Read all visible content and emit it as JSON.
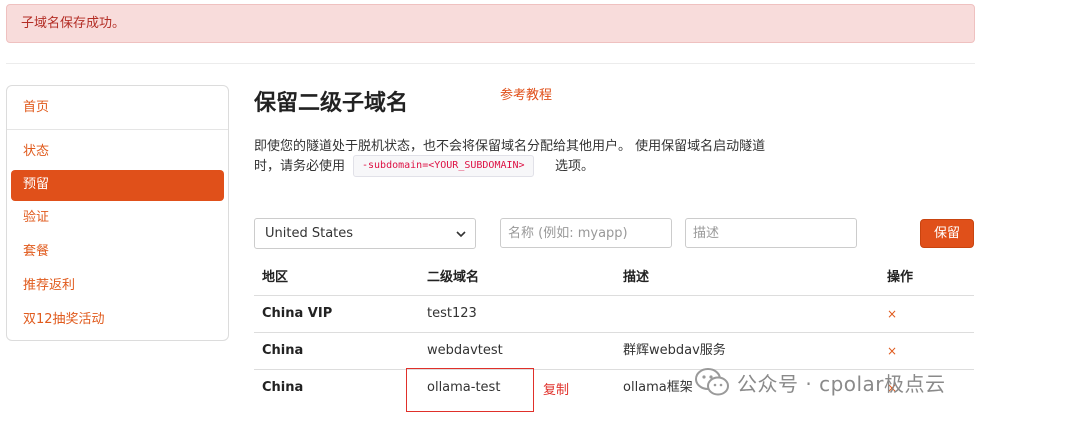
{
  "alert": {
    "message": "子域名保存成功。"
  },
  "sidebar": {
    "items": [
      {
        "label": "首页"
      },
      {
        "label": "状态"
      },
      {
        "label": "预留"
      },
      {
        "label": "验证"
      },
      {
        "label": "套餐"
      },
      {
        "label": "推荐返利"
      },
      {
        "label": "双12抽奖活动"
      }
    ],
    "active_index": 2
  },
  "main": {
    "title": "保留二级子域名",
    "tutorial_link": "参考教程",
    "description_line1": "即使您的隧道处于脱机状态，也不会将保留域名分配给其他用户。 使用保留域名启动隧道",
    "description_line2_prefix": "时，请务必使用",
    "description_code": "-subdomain=<YOUR_SUBDOMAIN>",
    "description_line2_suffix": "选项。"
  },
  "form": {
    "region_selected": "United States",
    "name_placeholder": "名称 (例如: myapp)",
    "desc_placeholder": "描述",
    "save_label": "保留"
  },
  "table": {
    "headers": {
      "region": "地区",
      "subdomain": "二级域名",
      "description": "描述",
      "action": "操作"
    },
    "rows": [
      {
        "region": "China VIP",
        "subdomain": "test123",
        "description": "",
        "delete": "×"
      },
      {
        "region": "China",
        "subdomain": "webdavtest",
        "description": "群辉webdav服务",
        "delete": "×"
      },
      {
        "region": "China",
        "subdomain": "ollama-test",
        "description": "ollama框架",
        "delete": "×"
      }
    ]
  },
  "annotation": {
    "copy_label": "复制"
  },
  "watermark": {
    "text": "公众号 · cpolar极点云",
    "icon": "wechat-icon"
  },
  "colors": {
    "accent": "#e0501a",
    "alert_bg": "#f8dcdb",
    "alert_text": "#b32d25",
    "annotation": "#e0302a"
  }
}
